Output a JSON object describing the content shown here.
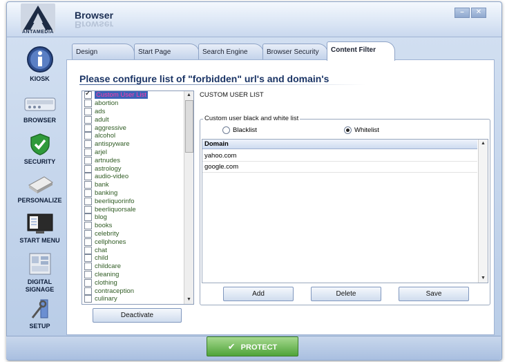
{
  "window": {
    "title": "Browser",
    "logo_text": "ANTAMEDIA",
    "minimize_glyph": "–",
    "close_glyph": "✕"
  },
  "sidebar": {
    "items": [
      {
        "label": "KIOSK",
        "icon": "kiosk-info-icon"
      },
      {
        "label": "BROWSER",
        "icon": "browser-icon"
      },
      {
        "label": "SECURITY",
        "icon": "security-shield-icon"
      },
      {
        "label": "PERSONALIZE",
        "icon": "personalize-icon"
      },
      {
        "label": "START MENU",
        "icon": "start-menu-icon"
      },
      {
        "label": "DIGITAL SIGNAGE",
        "icon": "digital-signage-icon"
      },
      {
        "label": "SETUP",
        "icon": "setup-icon"
      }
    ]
  },
  "tabs": [
    "Design",
    "Start Page",
    "Search Engine",
    "Browser Security",
    "Content Filter"
  ],
  "active_tab": "Content Filter",
  "heading": "Please configure list of \"forbidden\" url's and domain's",
  "categories": {
    "items": [
      {
        "label": "Custom User List",
        "checked": true,
        "selected": true
      },
      {
        "label": "abortion",
        "checked": false
      },
      {
        "label": "ads",
        "checked": false
      },
      {
        "label": "adult",
        "checked": false
      },
      {
        "label": "aggressive",
        "checked": false
      },
      {
        "label": "alcohol",
        "checked": false
      },
      {
        "label": "antispyware",
        "checked": false
      },
      {
        "label": "arjel",
        "checked": false
      },
      {
        "label": "artnudes",
        "checked": false
      },
      {
        "label": "astrology",
        "checked": false
      },
      {
        "label": "audio-video",
        "checked": false
      },
      {
        "label": "bank",
        "checked": false
      },
      {
        "label": "banking",
        "checked": false
      },
      {
        "label": "beerliquorinfo",
        "checked": false
      },
      {
        "label": "beerliquorsale",
        "checked": false
      },
      {
        "label": "blog",
        "checked": false
      },
      {
        "label": "books",
        "checked": false
      },
      {
        "label": "celebrity",
        "checked": false
      },
      {
        "label": "cellphones",
        "checked": false
      },
      {
        "label": "chat",
        "checked": false
      },
      {
        "label": "child",
        "checked": false
      },
      {
        "label": "childcare",
        "checked": false
      },
      {
        "label": "cleaning",
        "checked": false
      },
      {
        "label": "clothing",
        "checked": false
      },
      {
        "label": "contraception",
        "checked": false
      },
      {
        "label": "culinary",
        "checked": false
      }
    ],
    "deactivate_label": "Deactivate"
  },
  "custom_list": {
    "section_title": "CUSTOM USER LIST",
    "group_label": "Custom user black and white list",
    "blacklist_label": "Blacklist",
    "whitelist_label": "Whitelist",
    "selected_mode": "Whitelist",
    "column_header": "Domain",
    "domains": [
      "yahoo.com",
      "google.com"
    ],
    "add_label": "Add",
    "delete_label": "Delete",
    "save_label": "Save"
  },
  "protect_label": "PROTECT",
  "colors": {
    "accent": "#1a3465",
    "category_text": "#2f5b23",
    "selection_bg": "#3a62b8",
    "selection_text": "#ff3da8",
    "protect_green": "#4fa339"
  }
}
